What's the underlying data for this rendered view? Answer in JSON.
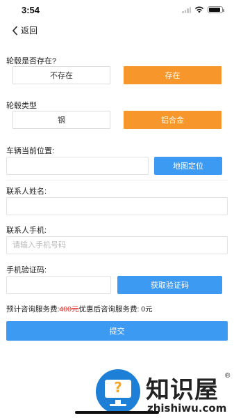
{
  "status_bar": {
    "time": "3:54",
    "battery_level": 0.9
  },
  "nav": {
    "back_label": "返回"
  },
  "hub_exists": {
    "label": "轮毂是否存在?",
    "options": [
      "不存在",
      "存在"
    ],
    "selected": "存在"
  },
  "hub_type": {
    "label": "轮毂类型",
    "options": [
      "钢",
      "铝合金"
    ],
    "selected": "铝合金"
  },
  "location": {
    "label": "车辆当前位置:",
    "value": "",
    "button_label": "地图定位"
  },
  "contact_name": {
    "label": "联系人姓名:",
    "value": ""
  },
  "contact_phone": {
    "label": "联系人手机:",
    "value": "",
    "placeholder": "请输入手机号码"
  },
  "verify_code": {
    "label": "手机验证码:",
    "value": "",
    "button_label": "获取验证码"
  },
  "fee": {
    "prefix": "预计咨询服务费:",
    "original": "400元",
    "after_label": "优惠后咨询服务费:",
    "after_value": "0元"
  },
  "submit_label": "提交",
  "watermark": {
    "title": "知识屋",
    "registered": "®",
    "url": "zhishiwu.com"
  },
  "colors": {
    "accent_orange": "#f7962a",
    "primary_blue": "#3d9af3",
    "strike_red": "#e53935"
  }
}
